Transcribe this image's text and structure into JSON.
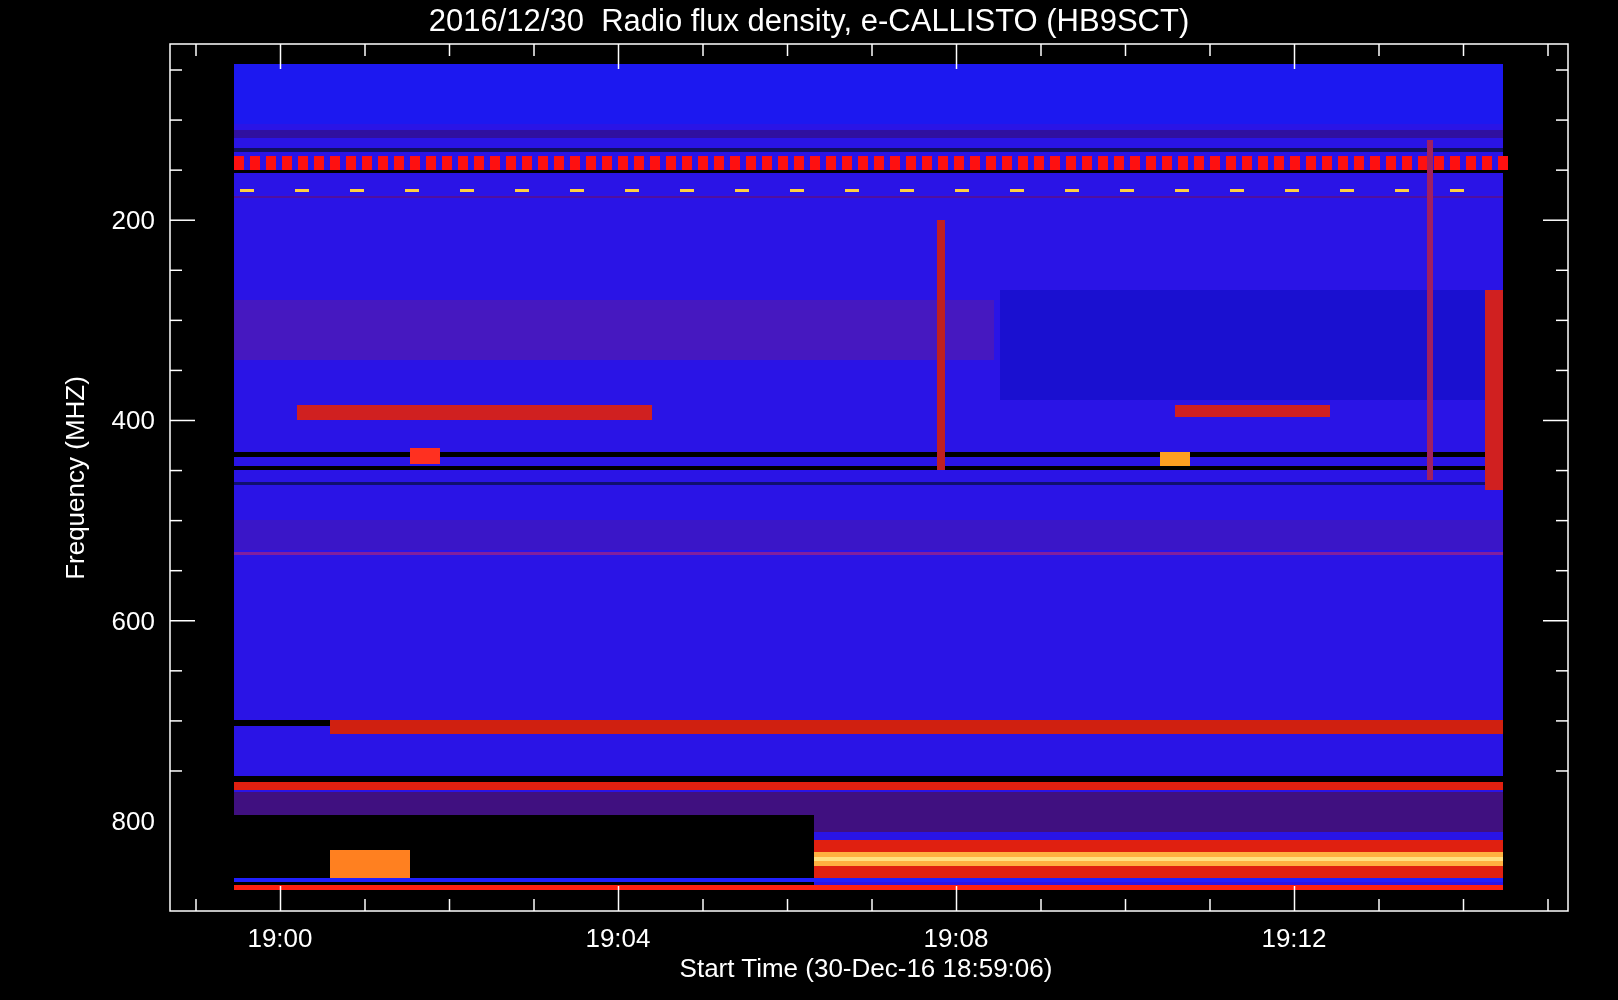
{
  "title": "2016/12/30  Radio flux density, e-CALLISTO (HB9SCT)",
  "y_axis": {
    "label": "Frequency (MHZ)",
    "ticks": [
      "200",
      "400",
      "600",
      "800"
    ]
  },
  "x_axis": {
    "label": "Start Time (30-Dec-16 18:59:06)",
    "ticks": [
      "19:00",
      "19:04",
      "19:08",
      "19:12"
    ]
  }
}
